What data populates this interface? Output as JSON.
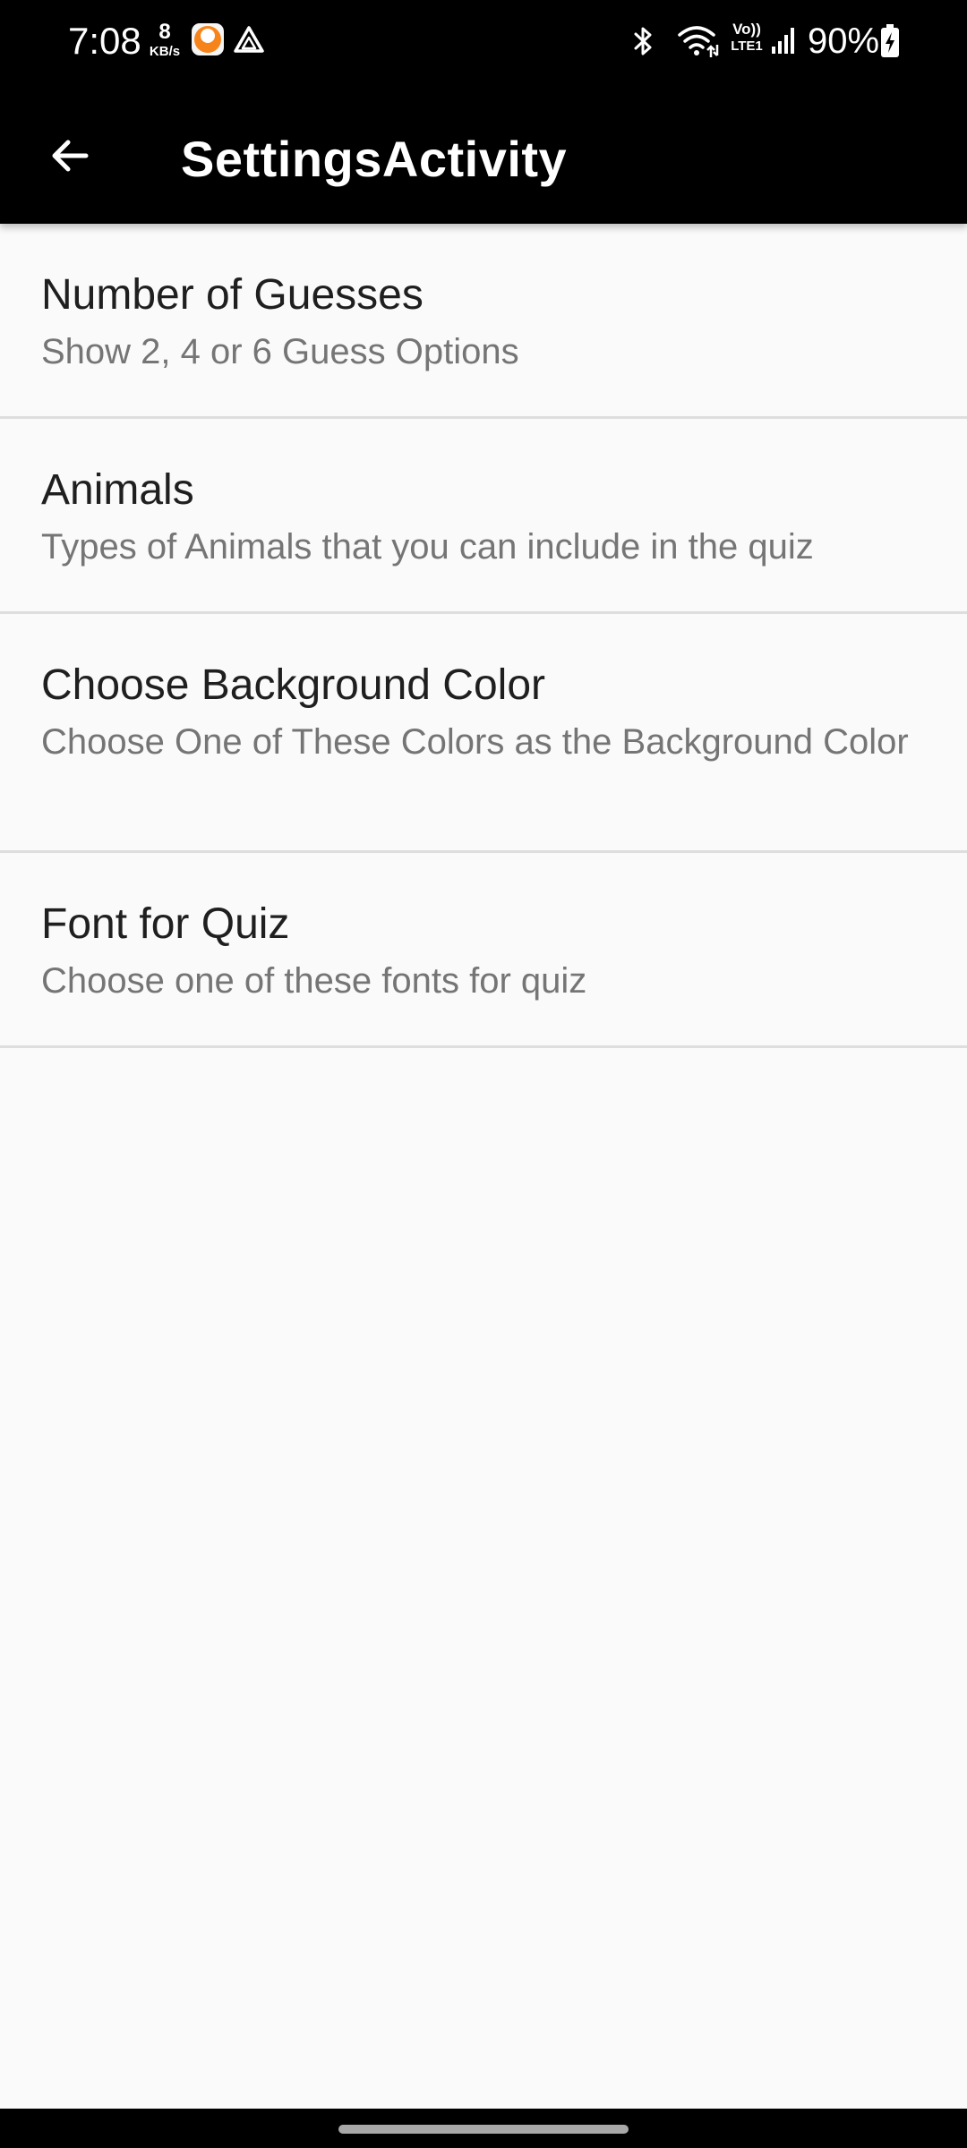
{
  "status_bar": {
    "time": "7:08",
    "net_speed_value": "8",
    "net_speed_unit": "KB/s",
    "volte_top": "Vo))",
    "volte_bottom": "LTE1",
    "battery_percent": "90%",
    "icons": [
      "orange-app-icon",
      "drive-icon",
      "bluetooth-icon",
      "wifi-icon",
      "volte-icon",
      "signal-icon",
      "battery-charging-icon"
    ]
  },
  "toolbar": {
    "title": "SettingsActivity",
    "back_icon": "arrow-back-icon"
  },
  "preferences": [
    {
      "title": "Number of Guesses",
      "summary": "Show 2, 4 or 6 Guess Options"
    },
    {
      "title": "Animals",
      "summary": "Types of Animals that you can include in the quiz"
    },
    {
      "title": "Choose Background Color",
      "summary": "Choose One of These Colors as the Background Color"
    },
    {
      "title": "Font for Quiz",
      "summary": "Choose one of these fonts for quiz"
    }
  ],
  "colors": {
    "app_bar": "#000000",
    "background": "#fafafa",
    "title_text": "#1f1f1f",
    "summary_text": "#757575",
    "divider": "#dedede"
  }
}
